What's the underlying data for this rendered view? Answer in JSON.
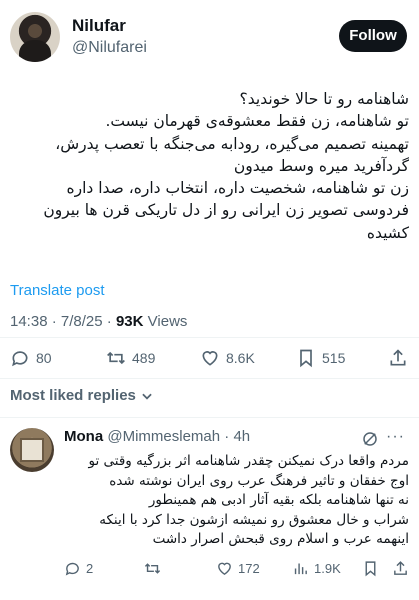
{
  "author": {
    "display_name": "Nilufar",
    "handle": "@Nilufarei",
    "follow_label": "Follow"
  },
  "tweet": {
    "lines": [
      "شاهنامه رو تا حالا خوندید؟",
      "تو شاهنامه، زن فقط معشوقه‌ی قهرمان نیست.",
      "تهمینه تصمیم می‌گیره، رودابه می‌جنگه با تعصب پدرش،",
      "گردآفرید میره وسط میدون",
      "زن تو شاهنامه، شخصیت داره، انتخاب داره، صدا داره",
      "فردوسی تصویر زن ایرانی رو از دل تاریکی قرن ها بیرون",
      "کشیده"
    ],
    "translate_label": "Translate post",
    "time": "14:38",
    "date": "7/8/25",
    "views_count": "93K",
    "views_label": "Views"
  },
  "actions": {
    "replies": "80",
    "reposts": "489",
    "likes": "8.6K",
    "bookmarks": "515"
  },
  "replies_sort": {
    "label": "Most liked replies"
  },
  "reply": {
    "name": "Mona",
    "handle": "@Mimmeslemah",
    "time": "4h",
    "lines": [
      "مردم واقعا درک نمیکنن چقدر شاهنامه اثر بزرگیه وقتی تو",
      "اوج خفقان و تاثیر فرهنگ عرب روی ایران نوشته شده",
      "نه تنها شاهنامه بلکه بقیه آثار ادبی هم همینطور",
      "شراب و خال معشوق رو نمیشه ازشون جدا کرد با اینکه",
      "اینهمه عرب و اسلام روی قبحش اصرار داشت"
    ],
    "replies": "2",
    "likes": "172",
    "views": "1.9K"
  }
}
